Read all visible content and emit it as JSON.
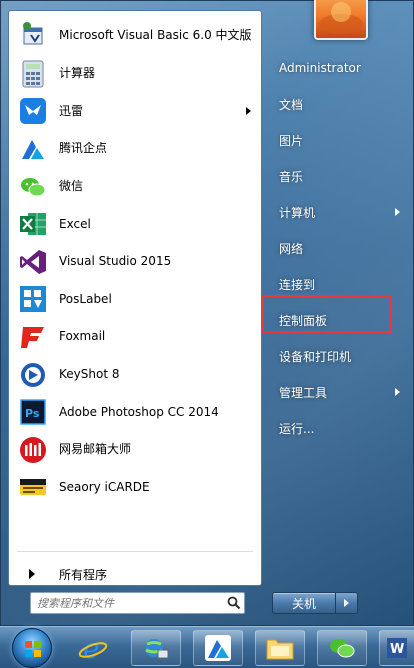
{
  "programs": [
    {
      "label": "Microsoft Visual Basic 6.0 中文版",
      "icon": "vb6-icon",
      "submenu": false
    },
    {
      "label": "计算器",
      "icon": "calculator-icon",
      "submenu": false
    },
    {
      "label": "迅雷",
      "icon": "xunlei-icon",
      "submenu": true
    },
    {
      "label": "腾讯企点",
      "icon": "tencent-qidian-icon",
      "submenu": false
    },
    {
      "label": "微信",
      "icon": "wechat-icon",
      "submenu": false
    },
    {
      "label": "Excel",
      "icon": "excel-icon",
      "submenu": false
    },
    {
      "label": "Visual Studio 2015",
      "icon": "visual-studio-icon",
      "submenu": false
    },
    {
      "label": "PosLabel",
      "icon": "poslabel-icon",
      "submenu": false
    },
    {
      "label": "Foxmail",
      "icon": "foxmail-icon",
      "submenu": false
    },
    {
      "label": "KeyShot 8",
      "icon": "keyshot-icon",
      "submenu": false
    },
    {
      "label": "Adobe Photoshop CC 2014",
      "icon": "photoshop-icon",
      "submenu": false
    },
    {
      "label": "网易邮箱大师",
      "icon": "netease-mail-icon",
      "submenu": false
    },
    {
      "label": "Seaory iCARDE",
      "icon": "seaory-icarde-icon",
      "submenu": false
    }
  ],
  "all_programs_label": "所有程序",
  "search": {
    "placeholder": "搜索程序和文件"
  },
  "right_menu": [
    {
      "label": "Administrator",
      "submenu": false
    },
    {
      "label": "文档",
      "submenu": false
    },
    {
      "label": "图片",
      "submenu": false
    },
    {
      "label": "音乐",
      "submenu": false
    },
    {
      "label": "计算机",
      "submenu": true
    },
    {
      "label": "网络",
      "submenu": false
    },
    {
      "label": "连接到",
      "submenu": false
    },
    {
      "label": "控制面板",
      "submenu": false
    },
    {
      "label": "设备和打印机",
      "submenu": false
    },
    {
      "label": "管理工具",
      "submenu": true
    },
    {
      "label": "运行...",
      "submenu": false
    }
  ],
  "highlighted_item": "控制面板",
  "shutdown_label": "关机",
  "colors": {
    "highlight_border": "#e8383b",
    "accent": "#2a5580"
  }
}
